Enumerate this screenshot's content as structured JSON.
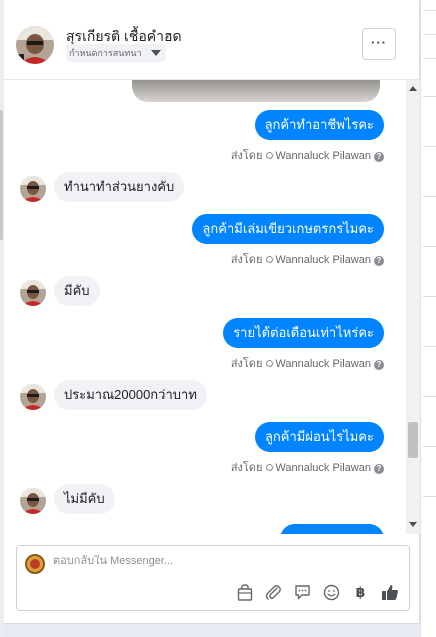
{
  "header": {
    "contact_name": "สุรเกียรติ เชื้อคำฮด",
    "status_label": "กำหนดการสนทนา",
    "more_label": "···"
  },
  "messages": [
    {
      "direction": "out",
      "text": "ลูกค้าทำอาชีพไรคะ",
      "sent_by_prefix": "ส่งโดย",
      "sender": "Wannaluck Pilawan",
      "help": "?"
    },
    {
      "direction": "in",
      "text": "ทำนาทำส่วนยางคับ"
    },
    {
      "direction": "out",
      "text": "ลูกค้ามีเล่มเขียวเกษตรกรไมคะ",
      "sent_by_prefix": "ส่งโดย",
      "sender": "Wannaluck Pilawan",
      "help": "?"
    },
    {
      "direction": "in",
      "text": "มีคับ"
    },
    {
      "direction": "out",
      "text": "รายได้ต่อเดือนเท่าไหร่คะ",
      "sent_by_prefix": "ส่งโดย",
      "sender": "Wannaluck Pilawan",
      "help": "?"
    },
    {
      "direction": "in",
      "text": "ประมาณ20000กว่าบาท"
    },
    {
      "direction": "out",
      "text": "ลูกค้ามีผ่อนไรไมคะ",
      "sent_by_prefix": "ส่งโดย",
      "sender": "Wannaluck Pilawan",
      "help": "?"
    },
    {
      "direction": "in",
      "text": "ไม่มีคับ"
    }
  ],
  "composer": {
    "placeholder": "ตอบกลับใน Messenger...",
    "value": "",
    "tools": [
      "bag-icon",
      "paperclip-icon",
      "speech-bubble-icon",
      "smiley-icon",
      "baht-icon",
      "thumbs-up-icon"
    ],
    "baht_glyph": "฿"
  },
  "colors": {
    "outgoing_bubble": "#0084ff",
    "incoming_bubble": "#f0f2f5",
    "panel_background": "#e6ebf2"
  }
}
